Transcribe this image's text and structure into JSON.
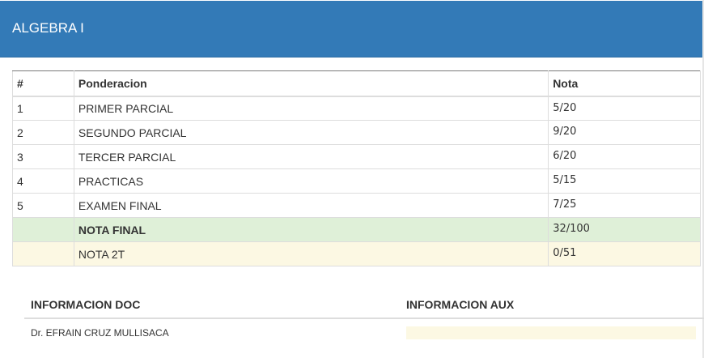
{
  "panel": {
    "title": "ALGEBRA I",
    "header_color": "#337ab7"
  },
  "grades": {
    "headers": {
      "num": "#",
      "ponderacion": "Ponderacion",
      "nota": "Nota"
    },
    "rows": [
      {
        "num": "1",
        "ponderacion": "PRIMER PARCIAL",
        "nota": "5/20"
      },
      {
        "num": "2",
        "ponderacion": "SEGUNDO PARCIAL",
        "nota": "9/20"
      },
      {
        "num": "3",
        "ponderacion": "TERCER PARCIAL",
        "nota": "6/20"
      },
      {
        "num": "4",
        "ponderacion": "PRACTICAS",
        "nota": "5/15"
      },
      {
        "num": "5",
        "ponderacion": "EXAMEN FINAL",
        "nota": "7/25"
      }
    ],
    "final": {
      "label": "NOTA FINAL",
      "nota": "32/100",
      "color": "#dff0d8"
    },
    "second_term": {
      "label": "NOTA 2T",
      "nota": "0/51",
      "color": "#fcf8e3"
    }
  },
  "info": {
    "doc_header": "INFORMACION DOC",
    "aux_header": "INFORMACION AUX",
    "doc_value": "Dr. EFRAIN CRUZ MULLISACA",
    "aux_value": ""
  }
}
